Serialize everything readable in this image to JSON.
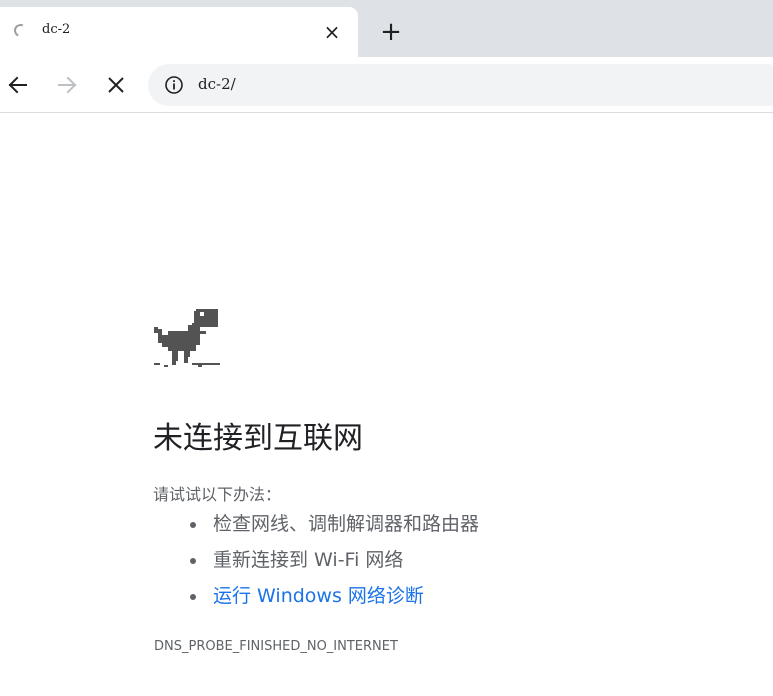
{
  "tab": {
    "title": "dc-2",
    "close_label": "×",
    "new_tab_label": "+"
  },
  "omnibox": {
    "url": "dc-2/"
  },
  "error_page": {
    "heading": "未连接到互联网",
    "try_label": "请试试以下办法：",
    "suggestions": [
      "检查网线、调制解调器和路由器",
      "重新连接到 Wi-Fi 网络",
      "运行 Windows 网络诊断"
    ],
    "error_code": "DNS_PROBE_FINISHED_NO_INTERNET"
  },
  "colors": {
    "tabstrip_bg": "#dee1e6",
    "text_primary": "#202124",
    "text_secondary": "#5f6368",
    "link": "#1a73e8",
    "omnibox_bg": "#f1f3f4"
  },
  "icons": {
    "loading": "loading-spinner-icon",
    "back": "arrow-back-icon",
    "forward": "arrow-forward-icon",
    "stop": "stop-close-icon",
    "info": "info-icon",
    "offline": "offline-dino-icon"
  }
}
